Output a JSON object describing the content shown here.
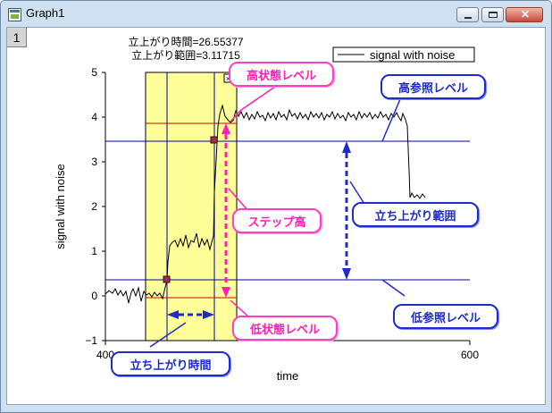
{
  "window": {
    "title": "Graph1",
    "layer_tab": "1"
  },
  "graph": {
    "text1": "立上がり時間=26.55377",
    "text2": "立上がり範囲=3.11715",
    "legend_label": "signal with noise",
    "xlabel": "time",
    "ylabel": "signal with noise",
    "x_ticks": [
      "400",
      "600"
    ],
    "y_ticks": [
      "5",
      "4",
      "3",
      "2",
      "1",
      "0",
      "−1"
    ]
  },
  "callouts": {
    "high_state": "高状態レベル",
    "high_ref": "高参照レベル",
    "step_height": "ステップ高",
    "rise_range": "立ち上がり範囲",
    "low_state": "低状態レベル",
    "low_ref": "低参照レベル",
    "rise_time": "立ち上がり時間"
  },
  "colors": {
    "highlight_fill": "#ffff99",
    "reference_line": "#0000a0",
    "state_line": "#cc0000",
    "callout_blue": "#1f2cc8",
    "callout_pink": "#ff1fb5",
    "marker": "#a0304a"
  }
}
